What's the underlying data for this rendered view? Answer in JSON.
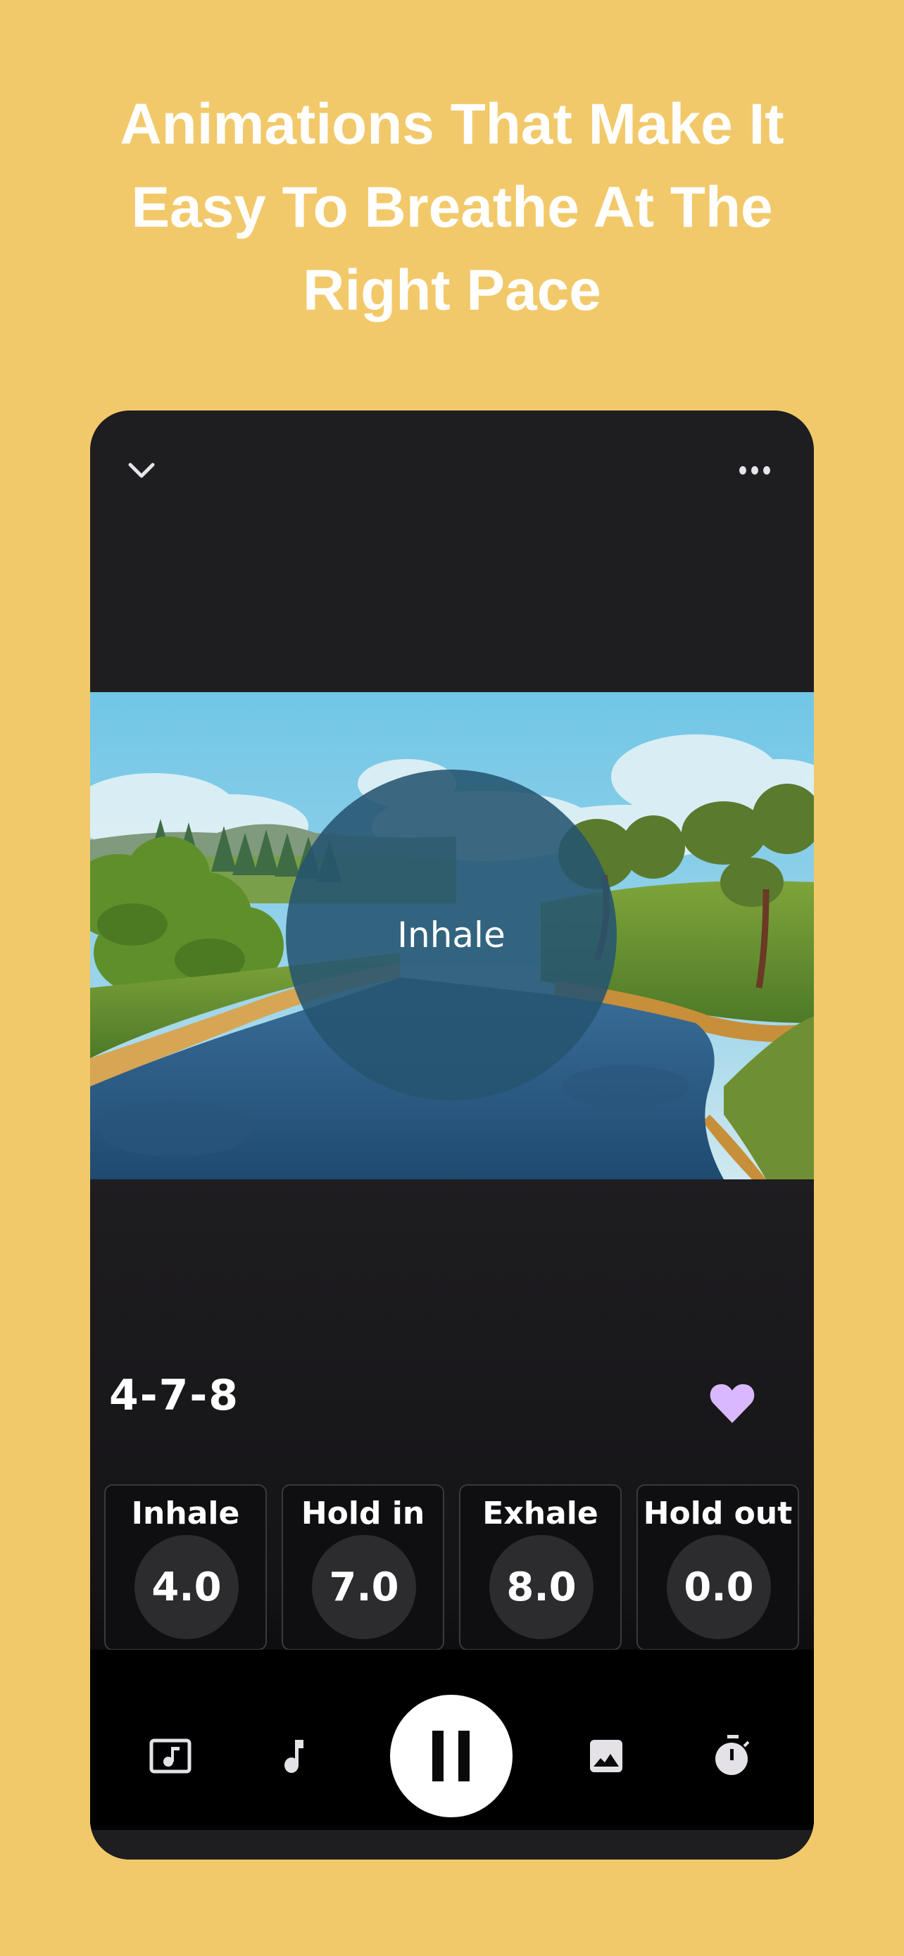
{
  "headline": {
    "lines": [
      "Animations That Make It",
      "Easy To Breathe At The",
      "Right Pace"
    ]
  },
  "player": {
    "header": {
      "collapse_icon": "chevron-down-icon",
      "menu_icon": "more-horizontal-icon"
    },
    "scene": {
      "description": "Cartoon river landscape with trees and hills",
      "phase_label": "Inhale"
    },
    "pattern": {
      "name": "4-7-8",
      "favorite": true,
      "favorite_color": "#D9B8FF"
    },
    "phases": [
      {
        "label": "Inhale",
        "value": "4.0"
      },
      {
        "label": "Hold in",
        "value": "7.0"
      },
      {
        "label": "Exhale",
        "value": "8.0"
      },
      {
        "label": "Hold out",
        "value": "0.0"
      }
    ],
    "toolbar": {
      "items": [
        {
          "name": "music-library",
          "icon": "music-box-icon"
        },
        {
          "name": "sound",
          "icon": "music-note-icon"
        },
        {
          "name": "play-pause",
          "icon": "pause-icon",
          "state": "playing"
        },
        {
          "name": "background",
          "icon": "image-icon"
        },
        {
          "name": "timer",
          "icon": "stopwatch-icon"
        }
      ]
    }
  },
  "colors": {
    "page_background": "#F2C96A",
    "app_background": "#1E1D20",
    "accent": "#D9B8FF"
  }
}
